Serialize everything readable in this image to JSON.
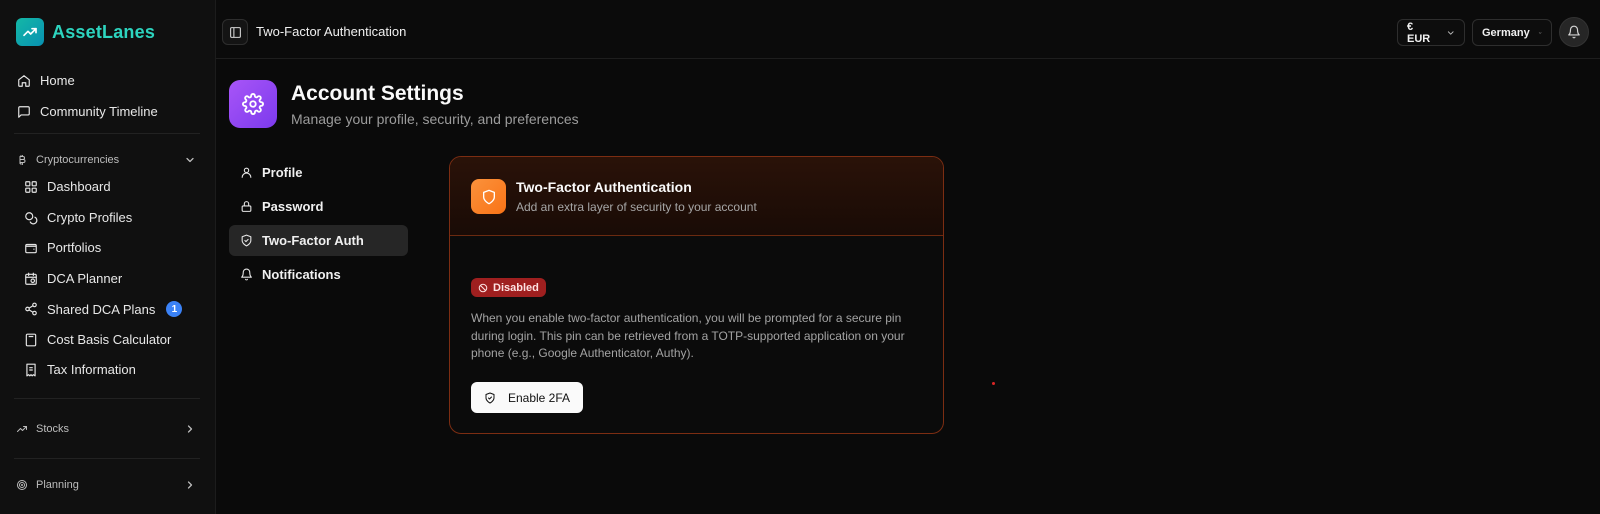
{
  "brand": {
    "name": "AssetLanes"
  },
  "sidebar": {
    "top_items": [
      {
        "label": "Home",
        "icon": "home-icon"
      },
      {
        "label": "Community Timeline",
        "icon": "message-square-icon"
      }
    ],
    "crypto_section": {
      "label": "Cryptocurrencies",
      "expanded": true,
      "items": [
        {
          "label": "Dashboard",
          "icon": "layout-grid-icon"
        },
        {
          "label": "Crypto Profiles",
          "icon": "coins-icon"
        },
        {
          "label": "Portfolios",
          "icon": "wallet-icon"
        },
        {
          "label": "DCA Planner",
          "icon": "calendar-clock-icon"
        },
        {
          "label": "Shared DCA Plans",
          "icon": "share-icon",
          "badge": "1"
        },
        {
          "label": "Cost Basis Calculator",
          "icon": "calculator-icon"
        },
        {
          "label": "Tax Information",
          "icon": "receipt-icon"
        }
      ]
    },
    "stocks_section": {
      "label": "Stocks",
      "expanded": false
    },
    "planning_section": {
      "label": "Planning",
      "expanded": false
    }
  },
  "topbar": {
    "title": "Two-Factor Authentication",
    "currency": "€ EUR",
    "country": "Germany"
  },
  "page": {
    "title": "Account Settings",
    "subtitle": "Manage your profile, security, and preferences"
  },
  "settings_nav": [
    {
      "label": "Profile",
      "active": false
    },
    {
      "label": "Password",
      "active": false
    },
    {
      "label": "Two-Factor Auth",
      "active": true
    },
    {
      "label": "Notifications",
      "active": false
    }
  ],
  "card": {
    "title": "Two-Factor Authentication",
    "subtitle": "Add an extra layer of security to your account",
    "status": "Disabled",
    "description": "When you enable two-factor authentication, you will be prompted for a secure pin during login. This pin can be retrieved from a TOTP-supported application on your phone (e.g., Google Authenticator, Authy).",
    "button_label": "Enable 2FA"
  },
  "colors": {
    "brand": "#2dd4bf",
    "accent_purple": "#a855f7",
    "accent_orange": "#f97316",
    "status_disabled": "#9f1f1f",
    "badge_blue": "#3b82f6"
  }
}
